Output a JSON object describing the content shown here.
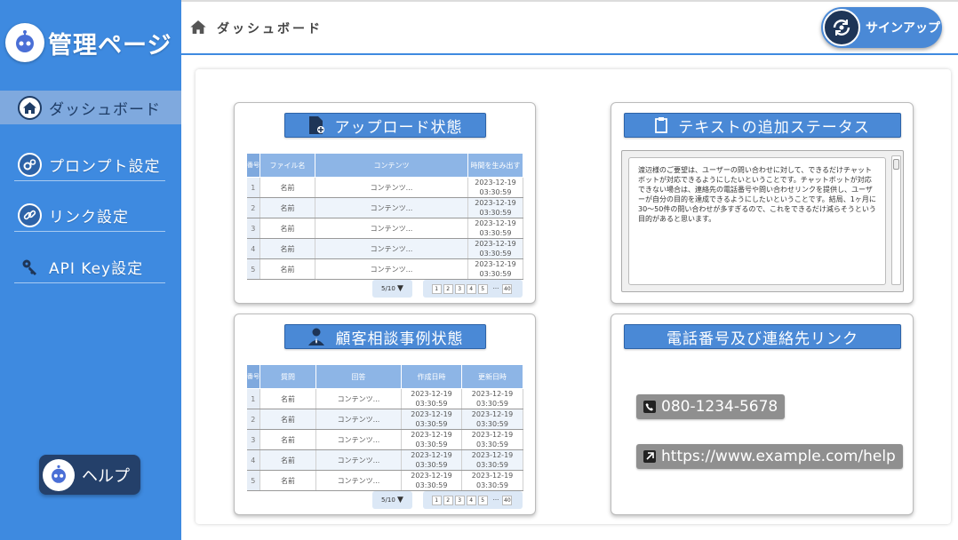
{
  "app": {
    "title": "管理ページ"
  },
  "sidebar": {
    "items": [
      {
        "label": "ダッシュボード",
        "icon": "home-icon",
        "active": true
      },
      {
        "label": "プロンプト設定",
        "icon": "gears-icon"
      },
      {
        "label": "リンク設定",
        "icon": "link-icon"
      },
      {
        "label": "API Key設定",
        "icon": "key-icon"
      }
    ],
    "help_label": "ヘルプ"
  },
  "header": {
    "breadcrumb": "ダッシュボード",
    "signup_label": "サインアップ"
  },
  "upload_card": {
    "title": "アップロード状態",
    "columns": [
      "番号",
      "ファイル名",
      "コンテンツ",
      "時間を生み出す"
    ],
    "rows": [
      {
        "num": "1",
        "name": "名前",
        "content": "コンテンツ...",
        "date": "2023-12-19",
        "time": "03:30:59"
      },
      {
        "num": "2",
        "name": "名前",
        "content": "コンテンツ...",
        "date": "2023-12-19",
        "time": "03:30:59"
      },
      {
        "num": "3",
        "name": "名前",
        "content": "コンテンツ...",
        "date": "2023-12-19",
        "time": "03:30:59"
      },
      {
        "num": "4",
        "name": "名前",
        "content": "コンテンツ...",
        "date": "2023-12-19",
        "time": "03:30:59"
      },
      {
        "num": "5",
        "name": "名前",
        "content": "コンテンツ...",
        "date": "2023-12-19",
        "time": "03:30:59"
      }
    ],
    "page_size": "5/10",
    "pages": [
      "1",
      "2",
      "3",
      "4",
      "5",
      "···",
      "40"
    ]
  },
  "text_card": {
    "title": "テキストの追加ステータス",
    "body": "渡辺様のご要望は、ユーザーの問い合わせに対して、できるだけチャットボットが対応できるようにしたいということです。チャットボットが対応できない場合は、連絡先の電話番号や問い合わせリンクを提供し、ユーザーが自分の目的を達成できるようにしたいということです。結局、1ヶ月に30～50件の問い合わせが多すぎるので、これをできるだけ減らそうという目的があると思います。"
  },
  "consult_card": {
    "title": "顧客相談事例状態",
    "columns": [
      "番号",
      "質問",
      "回答",
      "作成日時",
      "更新日時"
    ],
    "rows": [
      {
        "num": "1",
        "q": "名前",
        "a": "コンテンツ...",
        "c_date": "2023-12-19",
        "c_time": "03:30:59",
        "u_date": "2023-12-19",
        "u_time": "03:30:59"
      },
      {
        "num": "2",
        "q": "名前",
        "a": "コンテンツ...",
        "c_date": "2023-12-19",
        "c_time": "03:30:59",
        "u_date": "2023-12-19",
        "u_time": "03:30:59"
      },
      {
        "num": "3",
        "q": "名前",
        "a": "コンテンツ...",
        "c_date": "2023-12-19",
        "c_time": "03:30:59",
        "u_date": "2023-12-19",
        "u_time": "03:30:59"
      },
      {
        "num": "4",
        "q": "名前",
        "a": "コンテンツ...",
        "c_date": "2023-12-19",
        "c_time": "03:30:59",
        "u_date": "2023-12-19",
        "u_time": "03:30:59"
      },
      {
        "num": "5",
        "q": "名前",
        "a": "コンテンツ...",
        "c_date": "2023-12-19",
        "c_time": "03:30:59",
        "u_date": "2023-12-19",
        "u_time": "03:30:59"
      }
    ],
    "page_size": "5/10",
    "pages": [
      "1",
      "2",
      "3",
      "4",
      "5",
      "···",
      "40"
    ]
  },
  "contact_card": {
    "title": "電話番号及び連絡先リンク",
    "phone": "080-1234-5678",
    "link": "https://www.example.com/help"
  },
  "colors": {
    "sidebar": "#3e8ae0",
    "accent": "#4a89d6",
    "table_header": "#8db5e6",
    "contact_chip": "#8f8f8f"
  }
}
